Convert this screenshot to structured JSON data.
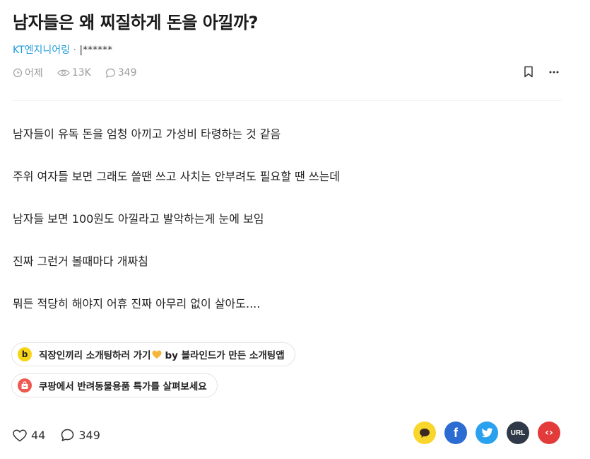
{
  "post": {
    "title": "남자들은 왜 찌질하게 돈을 아낄까?",
    "company": "KT엔지니어링",
    "separator": " · ",
    "nickname": "|******",
    "time": "어제",
    "views": "13K",
    "comments": "349"
  },
  "content": {
    "lines": [
      "남자들이 유독 돈을 엄청 아끼고 가성비 타령하는 것 같음",
      "주위 여자들 보면 그래도 쓸땐 쓰고 사치는 안부려도 필요할 땐 쓰는데",
      "남자들 보면 100원도 아낄라고 발악하는게 눈에 보임",
      "진짜 그런거 볼때마다 개짜침",
      "뭐든 적당히 해야지 어휴 진짜 아무리 없이 살아도...."
    ]
  },
  "promos": [
    {
      "text_before": "직장인끼리 소개팅하러 가기",
      "text_after": "by 블라인드가 만든 소개팅앱",
      "icon": "b-icon",
      "badge_color": "#f7d417"
    },
    {
      "text": "쿠팡에서 반려동물용품 특가를 살펴보세요",
      "icon": "coupang-bag-icon",
      "badge_color": "#ee5a52"
    }
  ],
  "footer": {
    "likes": "44",
    "comments": "349"
  },
  "share": {
    "kakao_color": "#f8d62b",
    "facebook_color": "#2c6bd1",
    "twitter_color": "#2aa1ee",
    "url_color": "#2f3947",
    "url_label": "URL",
    "embed_color": "#e23b39",
    "embed_label": "‹›"
  }
}
